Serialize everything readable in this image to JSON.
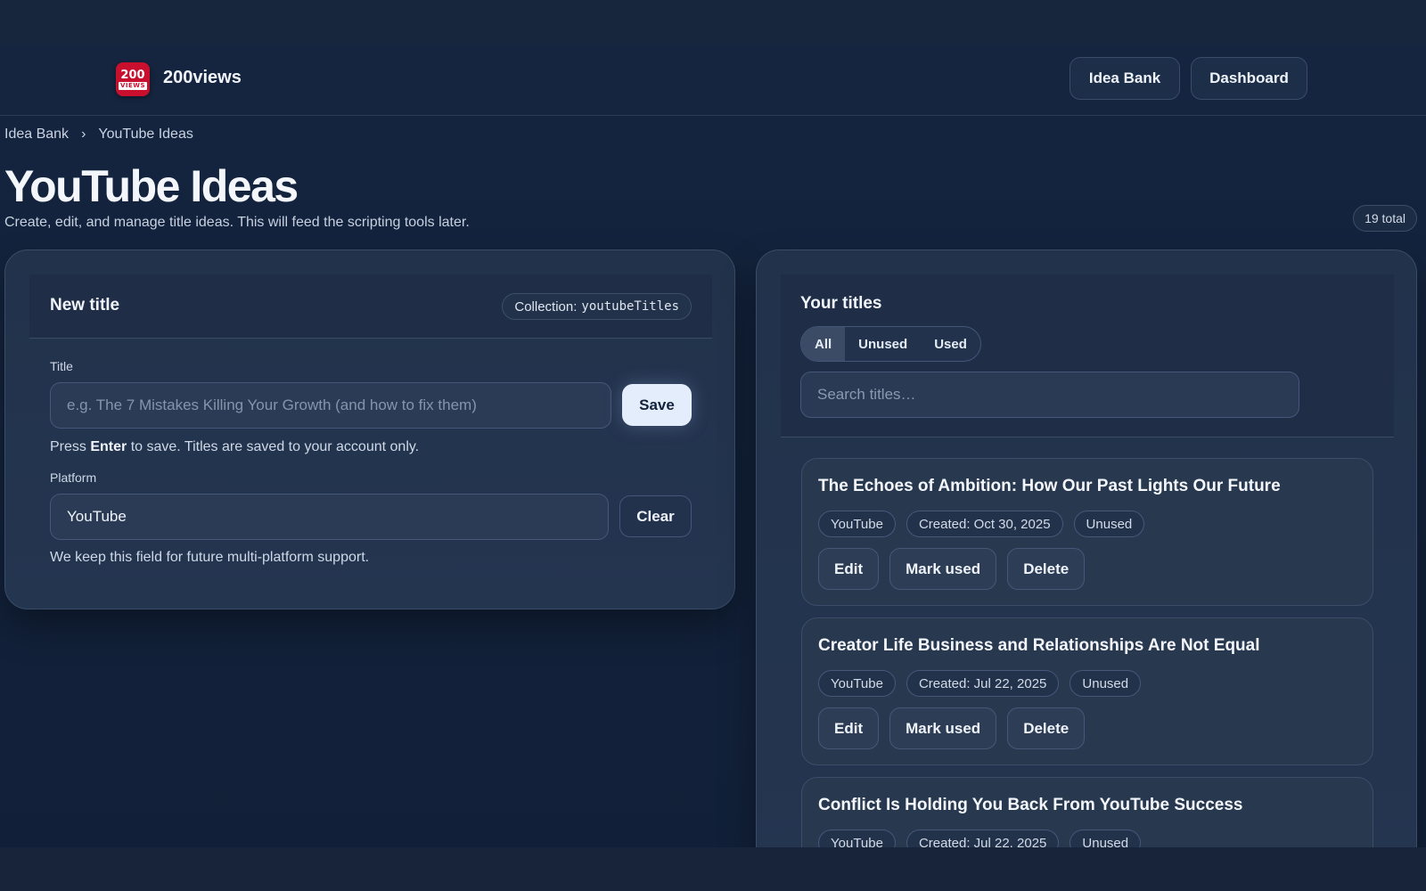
{
  "header": {
    "logo_top": "200",
    "logo_bottom": "VIEWS",
    "brand": "200views",
    "nav": [
      "Idea Bank",
      "Dashboard"
    ]
  },
  "breadcrumb": [
    "Idea Bank",
    "›",
    "YouTube Ideas"
  ],
  "page": {
    "title": "YouTube Ideas",
    "subtitle": "Create, edit, and manage title ideas. This will feed the scripting tools later.",
    "total": "19 total"
  },
  "new_title": {
    "heading": "New title",
    "collection_label": "Collection:",
    "collection_value": "youtubeTitles",
    "title_label": "Title",
    "title_placeholder": "e.g. The 7 Mistakes Killing Your Growth (and how to fix them)",
    "save": "Save",
    "hint_pre": "Press ",
    "hint_key": "Enter",
    "hint_post": " to save. Titles are saved to your account only.",
    "platform_label": "Platform",
    "platform_value": "YouTube",
    "clear": "Clear",
    "platform_hint": "We keep this field for future multi-platform support."
  },
  "titles": {
    "heading": "Your titles",
    "filters": [
      "All",
      "Unused",
      "Used"
    ],
    "active_filter": "All",
    "search_placeholder": "Search titles…",
    "items": [
      {
        "title": "The Echoes of Ambition: How Our Past Lights Our Future",
        "platform": "YouTube",
        "created": "Created: Oct 30, 2025",
        "status": "Unused"
      },
      {
        "title": "Creator Life Business and Relationships Are Not Equal",
        "platform": "YouTube",
        "created": "Created: Jul 22, 2025",
        "status": "Unused"
      },
      {
        "title": "Conflict Is Holding You Back From YouTube Success",
        "platform": "YouTube",
        "created": "Created: Jul 22, 2025",
        "status": "Unused"
      }
    ],
    "actions": [
      "Edit",
      "Mark used",
      "Delete"
    ]
  }
}
